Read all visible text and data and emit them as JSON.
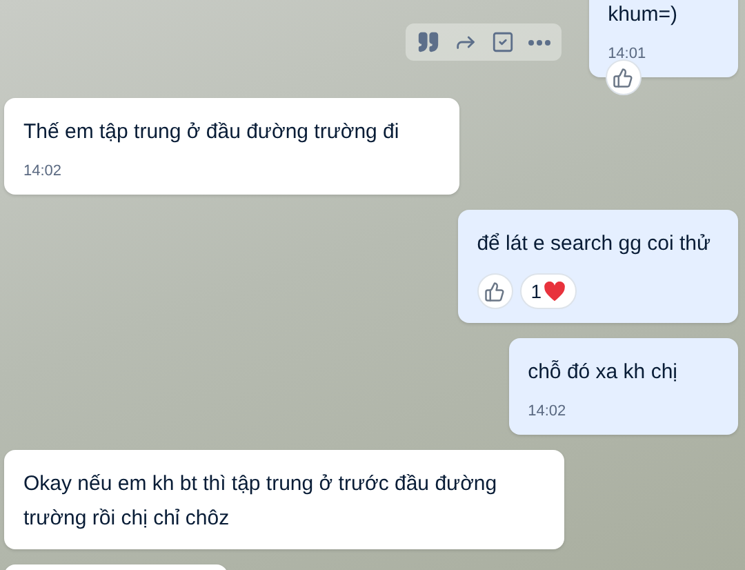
{
  "messages": [
    {
      "kind": "sent",
      "text": "khum=)",
      "time": "14:01",
      "cut_top": true,
      "actions_shown": true,
      "reactions": [
        {
          "kind": "like",
          "floating": true
        }
      ]
    },
    {
      "kind": "received",
      "text": "Thế em tập trung ở đầu đường trường đi",
      "time": "14:02"
    },
    {
      "kind": "sent",
      "text": "để lát e search gg coi thử",
      "reactions": [
        {
          "kind": "like"
        },
        {
          "kind": "heart",
          "count": "1"
        }
      ]
    },
    {
      "kind": "sent",
      "text": "chỗ đó xa kh chị",
      "time": "14:02"
    },
    {
      "kind": "received",
      "text": "Okay nếu em kh bt thì tập trung ở trước đầu đường trường rồi chị chỉ chôz"
    },
    {
      "kind": "received",
      "cut_bottom": true
    }
  ]
}
